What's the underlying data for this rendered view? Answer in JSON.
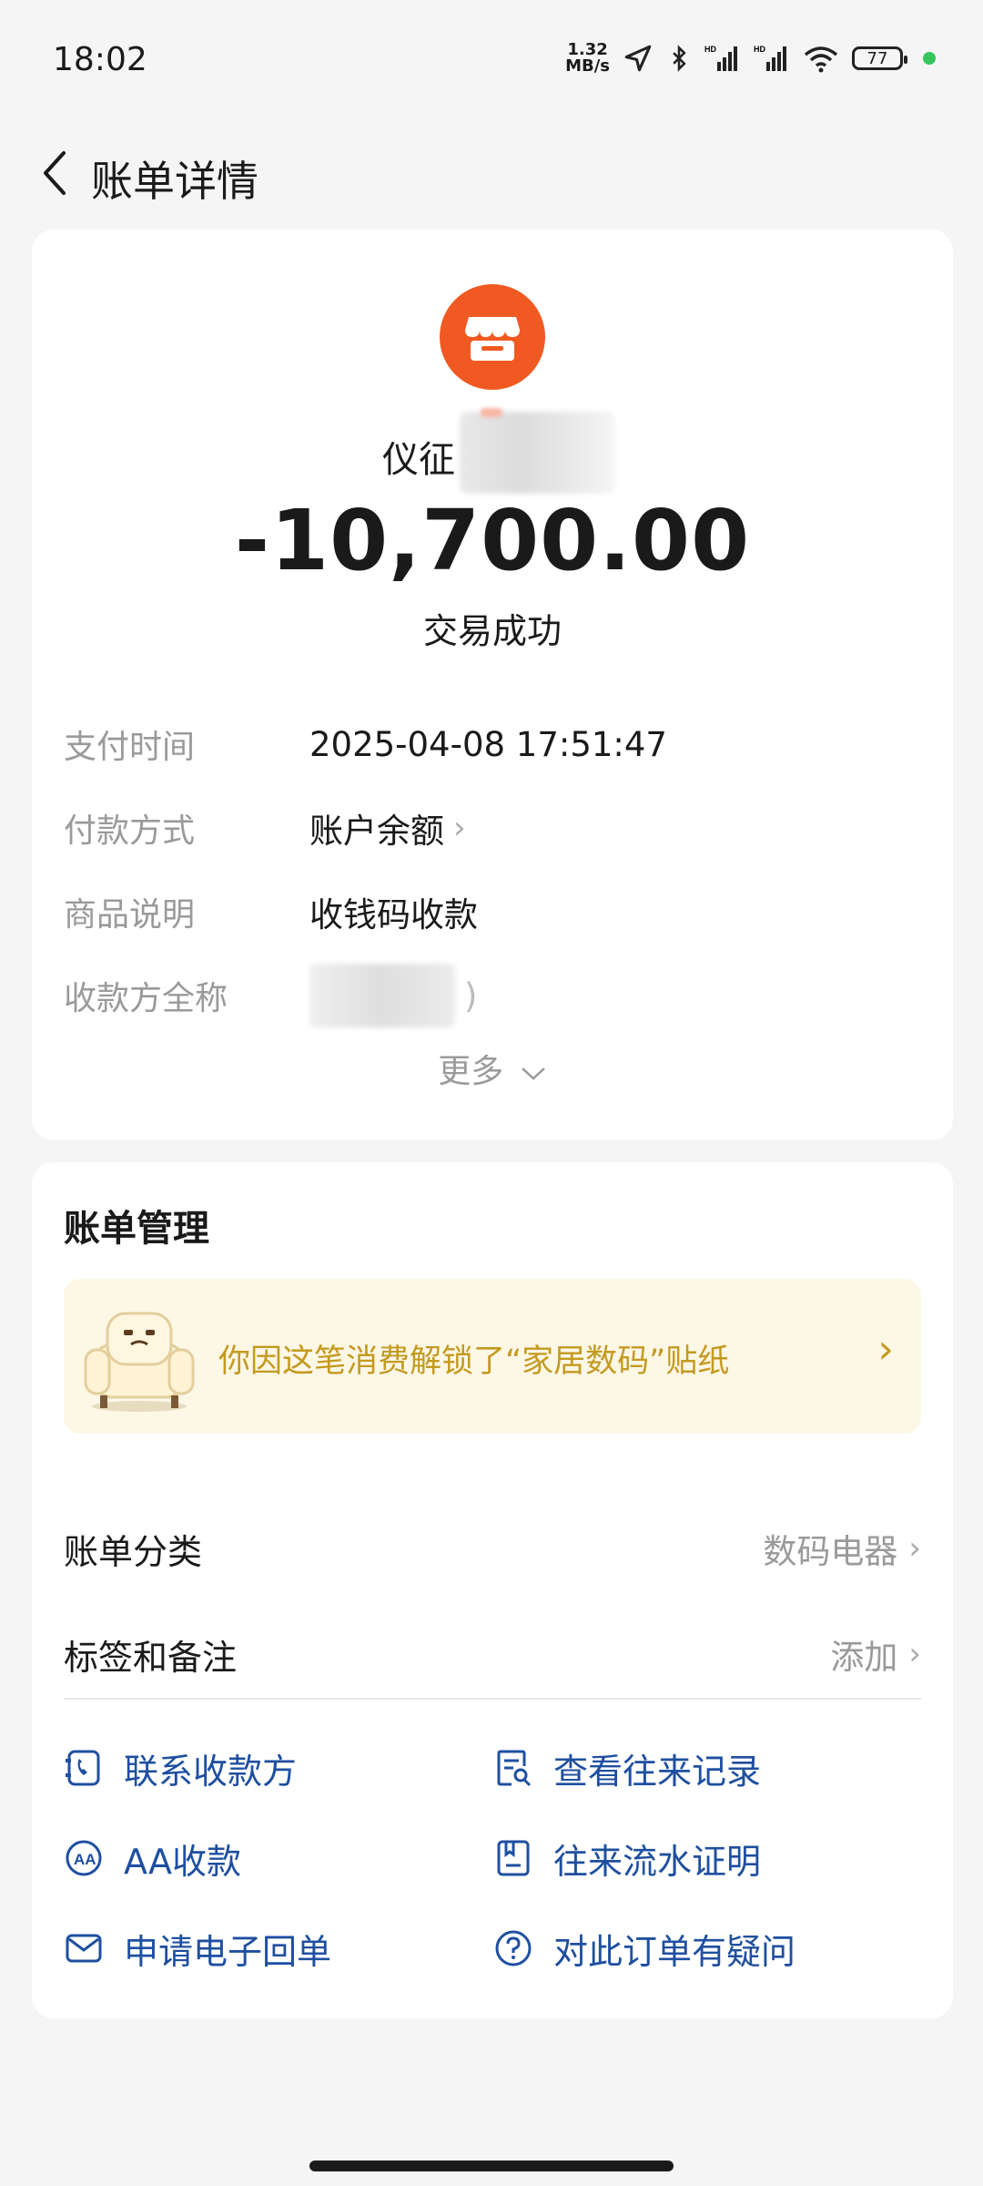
{
  "status_bar": {
    "time": "18:02",
    "net_speed_value": "1.32",
    "net_speed_unit": "MB/s",
    "battery": "77"
  },
  "header": {
    "title": "账单详情"
  },
  "bill": {
    "merchant_name": "仪征",
    "amount": "-10,700.00",
    "status": "交易成功",
    "details": [
      {
        "label": "支付时间",
        "value": "2025-04-08 17:51:47"
      },
      {
        "label": "付款方式",
        "value": "账户余额"
      },
      {
        "label": "商品说明",
        "value": "收钱码收款"
      },
      {
        "label": "收款方全称",
        "value": ")"
      }
    ],
    "more": "更多"
  },
  "management": {
    "title": "账单管理",
    "sticker_text": "你因这笔消费解锁了“家居数码”贴纸",
    "category_label": "账单分类",
    "category_value": "数码电器",
    "tags_label": "标签和备注",
    "tags_value": "添加",
    "actions": [
      {
        "label": "联系收款方",
        "icon": "phone-chat-icon"
      },
      {
        "label": "查看往来记录",
        "icon": "search-doc-icon"
      },
      {
        "label": "AA收款",
        "icon": "aa-icon"
      },
      {
        "label": "往来流水证明",
        "icon": "statement-icon"
      },
      {
        "label": "申请电子回单",
        "icon": "mail-icon"
      },
      {
        "label": "对此订单有疑问",
        "icon": "question-icon"
      }
    ]
  },
  "colors": {
    "accent_blue": "#1f4fa0",
    "merchant_orange": "#f05a22",
    "sticker_gold": "#c49a1f"
  }
}
